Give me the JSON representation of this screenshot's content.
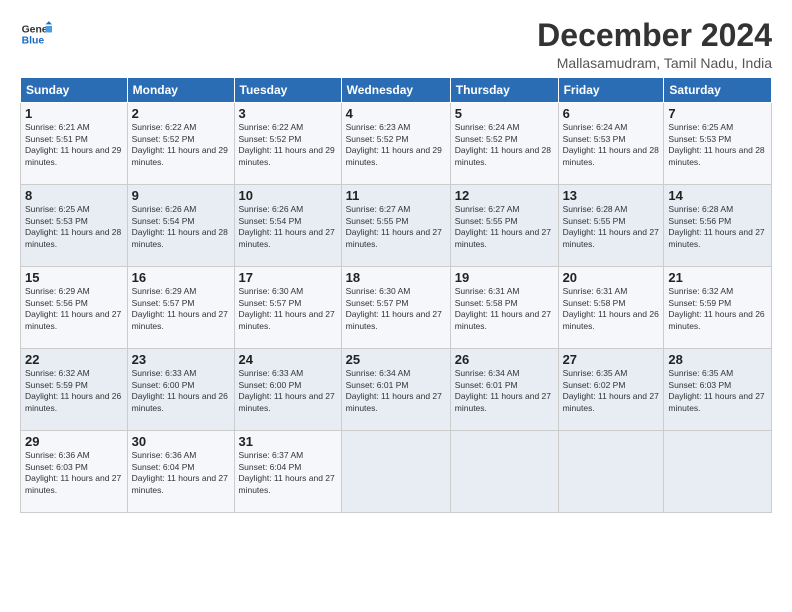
{
  "header": {
    "logo_line1": "General",
    "logo_line2": "Blue",
    "title": "December 2024",
    "subtitle": "Mallasamudram, Tamil Nadu, India"
  },
  "weekdays": [
    "Sunday",
    "Monday",
    "Tuesday",
    "Wednesday",
    "Thursday",
    "Friday",
    "Saturday"
  ],
  "weeks": [
    [
      {
        "day": "1",
        "sunrise": "Sunrise: 6:21 AM",
        "sunset": "Sunset: 5:51 PM",
        "daylight": "Daylight: 11 hours and 29 minutes."
      },
      {
        "day": "2",
        "sunrise": "Sunrise: 6:22 AM",
        "sunset": "Sunset: 5:52 PM",
        "daylight": "Daylight: 11 hours and 29 minutes."
      },
      {
        "day": "3",
        "sunrise": "Sunrise: 6:22 AM",
        "sunset": "Sunset: 5:52 PM",
        "daylight": "Daylight: 11 hours and 29 minutes."
      },
      {
        "day": "4",
        "sunrise": "Sunrise: 6:23 AM",
        "sunset": "Sunset: 5:52 PM",
        "daylight": "Daylight: 11 hours and 29 minutes."
      },
      {
        "day": "5",
        "sunrise": "Sunrise: 6:24 AM",
        "sunset": "Sunset: 5:52 PM",
        "daylight": "Daylight: 11 hours and 28 minutes."
      },
      {
        "day": "6",
        "sunrise": "Sunrise: 6:24 AM",
        "sunset": "Sunset: 5:53 PM",
        "daylight": "Daylight: 11 hours and 28 minutes."
      },
      {
        "day": "7",
        "sunrise": "Sunrise: 6:25 AM",
        "sunset": "Sunset: 5:53 PM",
        "daylight": "Daylight: 11 hours and 28 minutes."
      }
    ],
    [
      {
        "day": "8",
        "sunrise": "Sunrise: 6:25 AM",
        "sunset": "Sunset: 5:53 PM",
        "daylight": "Daylight: 11 hours and 28 minutes."
      },
      {
        "day": "9",
        "sunrise": "Sunrise: 6:26 AM",
        "sunset": "Sunset: 5:54 PM",
        "daylight": "Daylight: 11 hours and 28 minutes."
      },
      {
        "day": "10",
        "sunrise": "Sunrise: 6:26 AM",
        "sunset": "Sunset: 5:54 PM",
        "daylight": "Daylight: 11 hours and 27 minutes."
      },
      {
        "day": "11",
        "sunrise": "Sunrise: 6:27 AM",
        "sunset": "Sunset: 5:55 PM",
        "daylight": "Daylight: 11 hours and 27 minutes."
      },
      {
        "day": "12",
        "sunrise": "Sunrise: 6:27 AM",
        "sunset": "Sunset: 5:55 PM",
        "daylight": "Daylight: 11 hours and 27 minutes."
      },
      {
        "day": "13",
        "sunrise": "Sunrise: 6:28 AM",
        "sunset": "Sunset: 5:55 PM",
        "daylight": "Daylight: 11 hours and 27 minutes."
      },
      {
        "day": "14",
        "sunrise": "Sunrise: 6:28 AM",
        "sunset": "Sunset: 5:56 PM",
        "daylight": "Daylight: 11 hours and 27 minutes."
      }
    ],
    [
      {
        "day": "15",
        "sunrise": "Sunrise: 6:29 AM",
        "sunset": "Sunset: 5:56 PM",
        "daylight": "Daylight: 11 hours and 27 minutes."
      },
      {
        "day": "16",
        "sunrise": "Sunrise: 6:29 AM",
        "sunset": "Sunset: 5:57 PM",
        "daylight": "Daylight: 11 hours and 27 minutes."
      },
      {
        "day": "17",
        "sunrise": "Sunrise: 6:30 AM",
        "sunset": "Sunset: 5:57 PM",
        "daylight": "Daylight: 11 hours and 27 minutes."
      },
      {
        "day": "18",
        "sunrise": "Sunrise: 6:30 AM",
        "sunset": "Sunset: 5:57 PM",
        "daylight": "Daylight: 11 hours and 27 minutes."
      },
      {
        "day": "19",
        "sunrise": "Sunrise: 6:31 AM",
        "sunset": "Sunset: 5:58 PM",
        "daylight": "Daylight: 11 hours and 27 minutes."
      },
      {
        "day": "20",
        "sunrise": "Sunrise: 6:31 AM",
        "sunset": "Sunset: 5:58 PM",
        "daylight": "Daylight: 11 hours and 26 minutes."
      },
      {
        "day": "21",
        "sunrise": "Sunrise: 6:32 AM",
        "sunset": "Sunset: 5:59 PM",
        "daylight": "Daylight: 11 hours and 26 minutes."
      }
    ],
    [
      {
        "day": "22",
        "sunrise": "Sunrise: 6:32 AM",
        "sunset": "Sunset: 5:59 PM",
        "daylight": "Daylight: 11 hours and 26 minutes."
      },
      {
        "day": "23",
        "sunrise": "Sunrise: 6:33 AM",
        "sunset": "Sunset: 6:00 PM",
        "daylight": "Daylight: 11 hours and 26 minutes."
      },
      {
        "day": "24",
        "sunrise": "Sunrise: 6:33 AM",
        "sunset": "Sunset: 6:00 PM",
        "daylight": "Daylight: 11 hours and 27 minutes."
      },
      {
        "day": "25",
        "sunrise": "Sunrise: 6:34 AM",
        "sunset": "Sunset: 6:01 PM",
        "daylight": "Daylight: 11 hours and 27 minutes."
      },
      {
        "day": "26",
        "sunrise": "Sunrise: 6:34 AM",
        "sunset": "Sunset: 6:01 PM",
        "daylight": "Daylight: 11 hours and 27 minutes."
      },
      {
        "day": "27",
        "sunrise": "Sunrise: 6:35 AM",
        "sunset": "Sunset: 6:02 PM",
        "daylight": "Daylight: 11 hours and 27 minutes."
      },
      {
        "day": "28",
        "sunrise": "Sunrise: 6:35 AM",
        "sunset": "Sunset: 6:03 PM",
        "daylight": "Daylight: 11 hours and 27 minutes."
      }
    ],
    [
      {
        "day": "29",
        "sunrise": "Sunrise: 6:36 AM",
        "sunset": "Sunset: 6:03 PM",
        "daylight": "Daylight: 11 hours and 27 minutes."
      },
      {
        "day": "30",
        "sunrise": "Sunrise: 6:36 AM",
        "sunset": "Sunset: 6:04 PM",
        "daylight": "Daylight: 11 hours and 27 minutes."
      },
      {
        "day": "31",
        "sunrise": "Sunrise: 6:37 AM",
        "sunset": "Sunset: 6:04 PM",
        "daylight": "Daylight: 11 hours and 27 minutes."
      },
      null,
      null,
      null,
      null
    ]
  ]
}
